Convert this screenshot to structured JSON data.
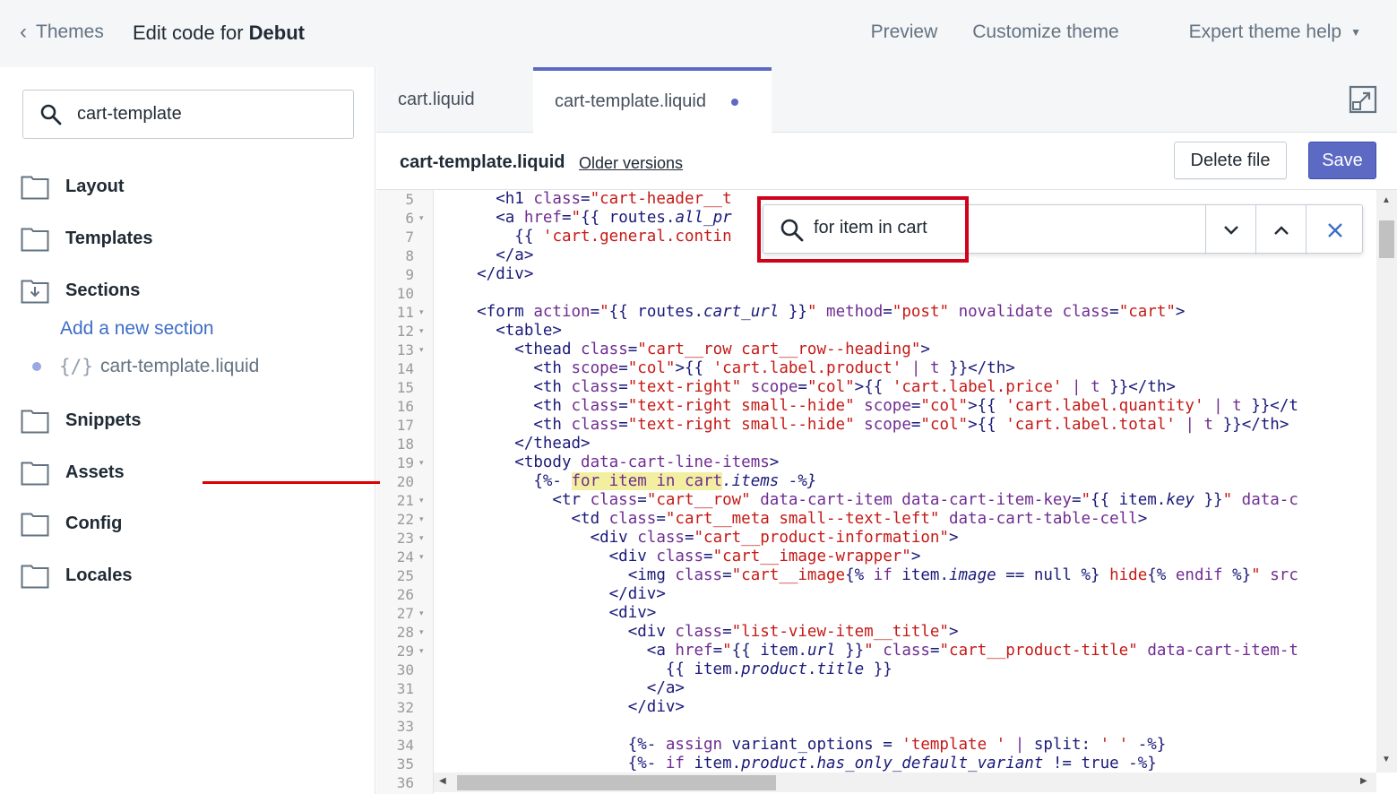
{
  "topbar": {
    "back_label": "Themes",
    "title_prefix": "Edit code for ",
    "title_theme": "Debut",
    "nav": [
      "Preview",
      "Customize theme",
      "Expert theme help"
    ]
  },
  "sidebar": {
    "search_value": "cart-template",
    "folders": [
      "Layout",
      "Templates",
      "Sections",
      "Snippets",
      "Assets",
      "Config",
      "Locales"
    ],
    "add_section": "Add a new section",
    "section_file": "cart-template.liquid",
    "liquid_icon": "{/}"
  },
  "tabs": [
    "cart.liquid",
    "cart-template.liquid"
  ],
  "file_header": {
    "filename": "cart-template.liquid",
    "older_versions": "Older versions",
    "delete_label": "Delete file",
    "save_label": "Save"
  },
  "find": {
    "value": "for item in cart"
  },
  "line_numbers": [
    "5",
    "6",
    "7",
    "8",
    "9",
    "10",
    "11",
    "12",
    "13",
    "14",
    "15",
    "16",
    "17",
    "18",
    "19",
    "20",
    "21",
    "22",
    "23",
    "24",
    "25",
    "26",
    "27",
    "28",
    "29",
    "30",
    "31",
    "32",
    "33",
    "34",
    "35",
    "36"
  ],
  "foldable_lines": [
    "6",
    "11",
    "12",
    "13",
    "19",
    "21",
    "22",
    "23",
    "24",
    "27",
    "28",
    "29"
  ],
  "code": {
    "l5": "      <h1 class=\"cart-header__t",
    "l6": "      <a href=\"{{ routes.all_pr",
    "l7": "        {{ 'cart.general.contin",
    "l8": "      </a>",
    "l9": "    </div>",
    "l10": "",
    "l11": "    <form action=\"{{ routes.cart_url }}\" method=\"post\" novalidate class=\"cart\">",
    "l12": "      <table>",
    "l13": "        <thead class=\"cart__row cart__row--heading\">",
    "l14": "          <th scope=\"col\">{{ 'cart.label.product' | t }}</th>",
    "l15": "          <th class=\"text-right\" scope=\"col\">{{ 'cart.label.price' | t }}</th>",
    "l16": "          <th class=\"text-right small--hide\" scope=\"col\">{{ 'cart.label.quantity' | t }}</t",
    "l17": "          <th class=\"text-right small--hide\" scope=\"col\">{{ 'cart.label.total' | t }}</th>",
    "l18": "        </thead>",
    "l19": "        <tbody data-cart-line-items>",
    "l20_pre": "          {%- ",
    "l20_hl": "for item in cart",
    "l20_post": ".items -%}",
    "l21": "            <tr class=\"cart__row\" data-cart-item data-cart-item-key=\"{{ item.key }}\" data-c",
    "l22": "              <td class=\"cart__meta small--text-left\" data-cart-table-cell>",
    "l23": "                <div class=\"cart__product-information\">",
    "l24": "                  <div class=\"cart__image-wrapper\">",
    "l25": "                    <img class=\"cart__image{% if item.image == null %} hide{% endif %}\" src",
    "l26": "                  </div>",
    "l27": "                  <div>",
    "l28": "                    <div class=\"list-view-item__title\">",
    "l29": "                      <a href=\"{{ item.url }}\" class=\"cart__product-title\" data-cart-item-t",
    "l30": "                        {{ item.product.title }}",
    "l31": "                      </a>",
    "l32": "                    </div>",
    "l33": "",
    "l34": "                    {%- assign variant_options = 'template ' | split: ' ' -%}",
    "l35": "                    {%- if item.product.has_only_default_variant != true -%}",
    "l36": ""
  }
}
